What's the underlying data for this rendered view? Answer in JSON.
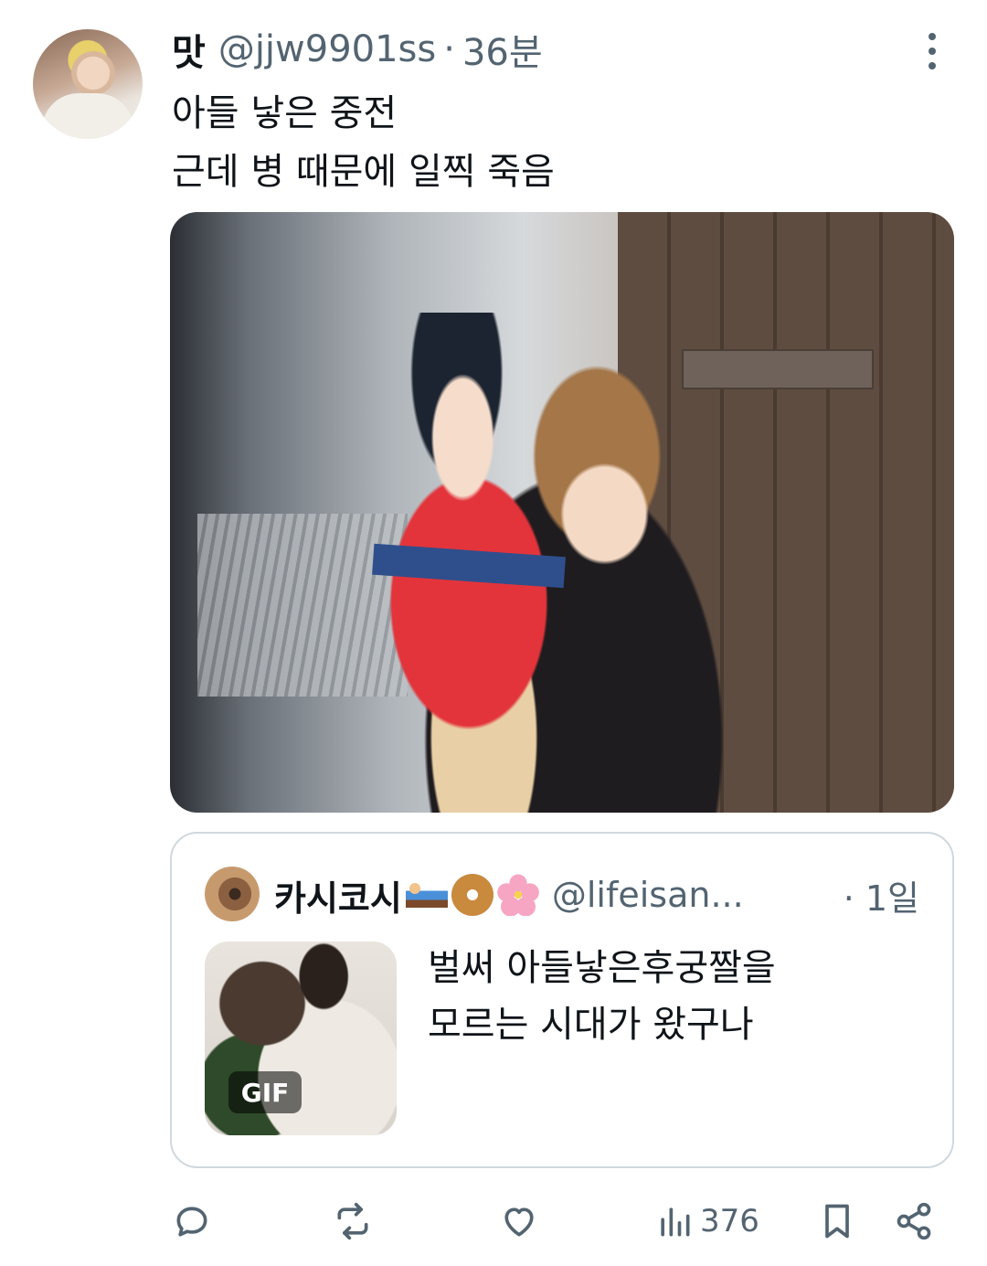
{
  "tweet": {
    "author_name": "맛",
    "handle": "@jjw9901ss",
    "separator": "·",
    "time": "36분",
    "text_lines": [
      "아들 낳은 중전",
      "근데 병 때문에 일찍 죽음"
    ]
  },
  "quote": {
    "author_name": "카시코시",
    "emojis": [
      "bed-emoji",
      "donut-emoji",
      "cherry-blossom-emoji"
    ],
    "handle": "@lifeisan...",
    "time": "· 1일",
    "gif_badge": "GIF",
    "text_lines": [
      "벌써 아들낳은후궁짤을",
      "모르는 시대가 왔구나"
    ]
  },
  "actions": {
    "reply_icon": "reply-icon",
    "retweet_icon": "retweet-icon",
    "like_icon": "heart-icon",
    "views_icon": "views-icon",
    "views_count": "376",
    "bookmark_icon": "bookmark-icon",
    "share_icon": "share-icon"
  },
  "colors": {
    "text": "#0f1419",
    "secondary": "#536471",
    "border": "#cfd9de"
  }
}
